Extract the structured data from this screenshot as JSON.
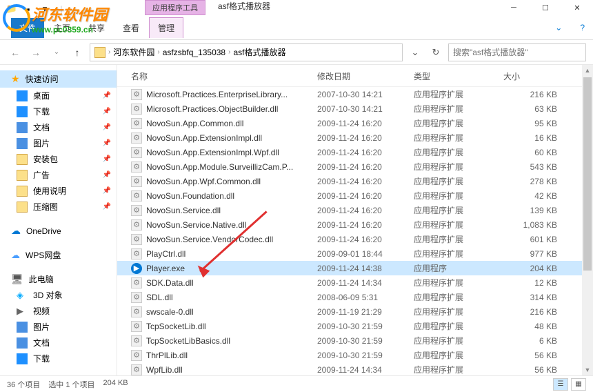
{
  "window": {
    "tool_tab": "应用程序工具",
    "title": "asf格式播放器",
    "ribbon_tabs": [
      "主页",
      "共享",
      "查看",
      "管理"
    ]
  },
  "address": {
    "crumbs": [
      "河东软件园",
      "asfzsbfq_135038",
      "asf格式播放器"
    ],
    "search_placeholder": "搜索\"asf格式播放器\""
  },
  "sidebar": {
    "quick_access": "快速访问",
    "items": [
      {
        "label": "桌面",
        "icon": "desk"
      },
      {
        "label": "下载",
        "icon": "down"
      },
      {
        "label": "文档",
        "icon": "doc"
      },
      {
        "label": "图片",
        "icon": "pic"
      },
      {
        "label": "安装包",
        "icon": "fold"
      },
      {
        "label": "广告",
        "icon": "fold"
      },
      {
        "label": "使用说明",
        "icon": "fold"
      },
      {
        "label": "压缩图",
        "icon": "fold"
      }
    ],
    "onedrive": "OneDrive",
    "wps": "WPS网盘",
    "thispc": "此电脑",
    "pc_items": [
      {
        "label": "3D 对象",
        "icon": "threed"
      },
      {
        "label": "视频",
        "icon": "video"
      },
      {
        "label": "图片",
        "icon": "pic"
      },
      {
        "label": "文档",
        "icon": "doc"
      },
      {
        "label": "下载",
        "icon": "down"
      }
    ]
  },
  "columns": {
    "name": "名称",
    "date": "修改日期",
    "type": "类型",
    "size": "大小"
  },
  "files": [
    {
      "name": "Microsoft.Practices.EnterpriseLibrary...",
      "date": "2007-10-30 14:21",
      "type": "应用程序扩展",
      "size": "216 KB",
      "icon": "dll"
    },
    {
      "name": "Microsoft.Practices.ObjectBuilder.dll",
      "date": "2007-10-30 14:21",
      "type": "应用程序扩展",
      "size": "63 KB",
      "icon": "dll"
    },
    {
      "name": "NovoSun.App.Common.dll",
      "date": "2009-11-24 16:20",
      "type": "应用程序扩展",
      "size": "95 KB",
      "icon": "dll"
    },
    {
      "name": "NovoSun.App.ExtensionImpl.dll",
      "date": "2009-11-24 16:20",
      "type": "应用程序扩展",
      "size": "16 KB",
      "icon": "dll"
    },
    {
      "name": "NovoSun.App.ExtensionImpl.Wpf.dll",
      "date": "2009-11-24 16:20",
      "type": "应用程序扩展",
      "size": "60 KB",
      "icon": "dll"
    },
    {
      "name": "NovoSun.App.Module.SurveillizCam.P...",
      "date": "2009-11-24 16:20",
      "type": "应用程序扩展",
      "size": "543 KB",
      "icon": "dll"
    },
    {
      "name": "NovoSun.App.Wpf.Common.dll",
      "date": "2009-11-24 16:20",
      "type": "应用程序扩展",
      "size": "278 KB",
      "icon": "dll"
    },
    {
      "name": "NovoSun.Foundation.dll",
      "date": "2009-11-24 16:20",
      "type": "应用程序扩展",
      "size": "42 KB",
      "icon": "dll"
    },
    {
      "name": "NovoSun.Service.dll",
      "date": "2009-11-24 16:20",
      "type": "应用程序扩展",
      "size": "139 KB",
      "icon": "dll"
    },
    {
      "name": "NovoSun.Service.Native.dll",
      "date": "2009-11-24 16:20",
      "type": "应用程序扩展",
      "size": "1,083 KB",
      "icon": "dll"
    },
    {
      "name": "NovoSun.Service.VendorCodec.dll",
      "date": "2009-11-24 16:20",
      "type": "应用程序扩展",
      "size": "601 KB",
      "icon": "dll"
    },
    {
      "name": "PlayCtrl.dll",
      "date": "2009-09-01 18:44",
      "type": "应用程序扩展",
      "size": "977 KB",
      "icon": "dll"
    },
    {
      "name": "Player.exe",
      "date": "2009-11-24 14:38",
      "type": "应用程序",
      "size": "204 KB",
      "icon": "exe",
      "selected": true
    },
    {
      "name": "SDK.Data.dll",
      "date": "2009-11-24 14:34",
      "type": "应用程序扩展",
      "size": "12 KB",
      "icon": "dll"
    },
    {
      "name": "SDL.dll",
      "date": "2008-06-09 5:31",
      "type": "应用程序扩展",
      "size": "314 KB",
      "icon": "dll"
    },
    {
      "name": "swscale-0.dll",
      "date": "2009-11-19 21:29",
      "type": "应用程序扩展",
      "size": "216 KB",
      "icon": "dll"
    },
    {
      "name": "TcpSocketLib.dll",
      "date": "2009-10-30 21:59",
      "type": "应用程序扩展",
      "size": "48 KB",
      "icon": "dll"
    },
    {
      "name": "TcpSocketLibBasics.dll",
      "date": "2009-10-30 21:59",
      "type": "应用程序扩展",
      "size": "6 KB",
      "icon": "dll"
    },
    {
      "name": "ThrPlLib.dll",
      "date": "2009-10-30 21:59",
      "type": "应用程序扩展",
      "size": "56 KB",
      "icon": "dll"
    },
    {
      "name": "WpfLib.dll",
      "date": "2009-11-24 14:34",
      "type": "应用程序扩展",
      "size": "56 KB",
      "icon": "dll"
    }
  ],
  "status": {
    "count": "36 个项目",
    "selected": "选中 1 个项目",
    "size": "204 KB"
  },
  "watermark": {
    "title": "河东软件园",
    "url": "www.pc0359.cn"
  }
}
